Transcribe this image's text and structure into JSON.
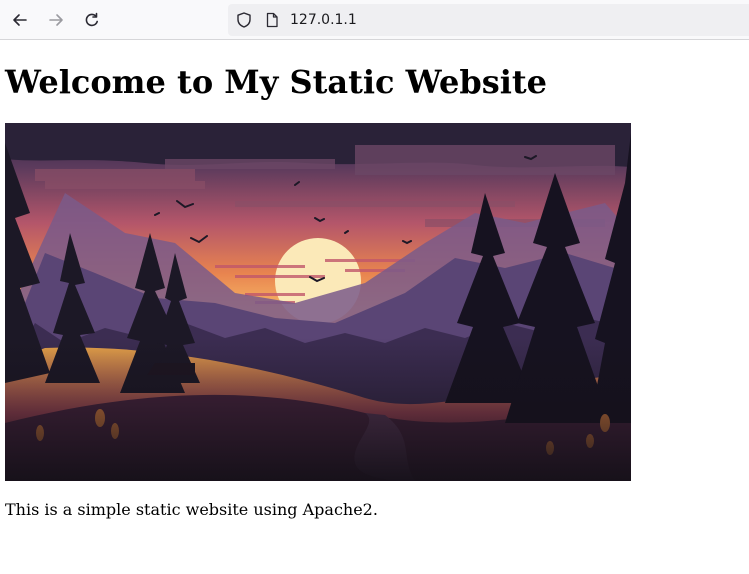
{
  "browser": {
    "url": "127.0.1.1",
    "icons": {
      "back": "arrow-left-icon",
      "forward": "arrow-right-icon",
      "reload": "reload-icon",
      "security": "shield-icon",
      "page": "page-icon"
    }
  },
  "page": {
    "heading": "Welcome to My Static Website",
    "image_subject": "sunset-mountain-landscape",
    "body_text": "This is a simple static website using Apache2."
  }
}
